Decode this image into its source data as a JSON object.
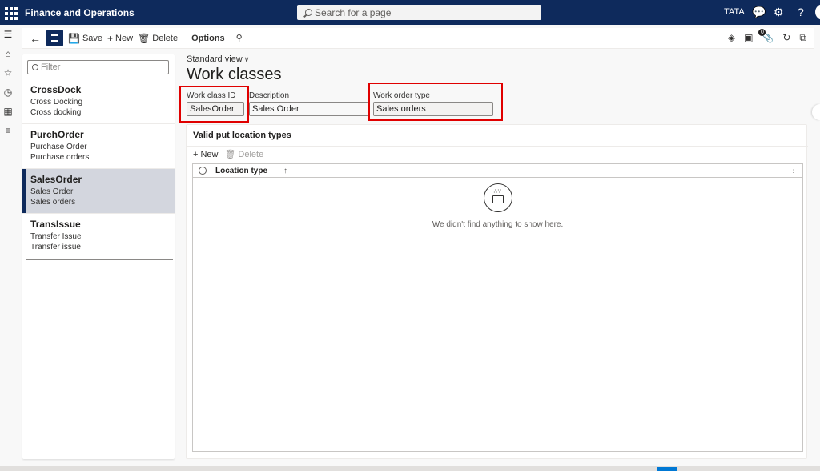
{
  "app": {
    "title": "Finance and Operations",
    "search_placeholder": "Search for a page",
    "company": "TATA"
  },
  "topbar_icons": [
    "waffle-icon",
    "chat-icon",
    "gear-icon",
    "help-icon",
    "avatar"
  ],
  "rail": [
    "hamburger-icon",
    "home-icon",
    "star-icon",
    "clock-icon",
    "workspace-icon",
    "modules-icon"
  ],
  "action_pane": {
    "save": "Save",
    "new": "New",
    "delete": "Delete",
    "options": "Options",
    "right_icons": [
      "diamond-icon",
      "office-icon",
      "attachments-icon",
      "refresh-icon",
      "open-new-window-icon"
    ],
    "attachments_count": "0"
  },
  "list": {
    "filter_placeholder": "Filter",
    "items": [
      {
        "id": "CrossDock",
        "line1": "Cross Docking",
        "line2": "Cross docking"
      },
      {
        "id": "PurchOrder",
        "line1": "Purchase Order",
        "line2": "Purchase orders"
      },
      {
        "id": "SalesOrder",
        "line1": "Sales Order",
        "line2": "Sales orders"
      },
      {
        "id": "TransIssue",
        "line1": "Transfer Issue",
        "line2": "Transfer issue"
      }
    ],
    "selected_index": 2
  },
  "view": {
    "label": "Standard view"
  },
  "page": {
    "title": "Work classes"
  },
  "fields": {
    "work_class_id": {
      "label": "Work class ID",
      "value": "SalesOrder"
    },
    "description": {
      "label": "Description",
      "value": "Sales Order"
    },
    "work_order_type": {
      "label": "Work order type",
      "value": "Sales orders"
    }
  },
  "section": {
    "title": "Valid put location types",
    "new": "New",
    "delete": "Delete",
    "column": "Location type",
    "empty_message": "We didn't find anything to show here."
  },
  "colors": {
    "nav": "#0e2a5c",
    "highlight": "#e00000",
    "selected_row": "#d3d6de"
  }
}
